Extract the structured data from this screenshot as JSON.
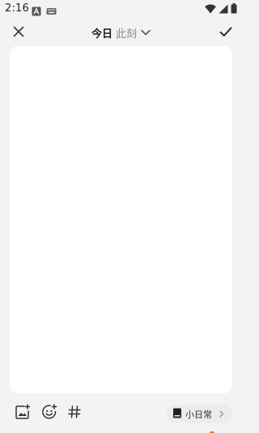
{
  "status_bar": {
    "time": "2:16",
    "icons": [
      "font-a-notification-icon",
      "keyboard-notification-icon",
      "wifi-icon",
      "cellular-signal-icon",
      "battery-icon"
    ]
  },
  "toolbar": {
    "title": "今日",
    "subtitle": "此刻",
    "close_icon": "close-icon",
    "confirm_icon": "checkmark-icon",
    "dropdown_icon": "chevron-down-icon"
  },
  "editor": {
    "content": ""
  },
  "bottom_bar": {
    "icons": [
      "add-image-icon",
      "add-emoji-icon",
      "hashtag-icon"
    ],
    "category": {
      "label": "小日常",
      "icon": "notebook-icon",
      "chevron": "chevron-right-icon"
    }
  },
  "colors": {
    "background": "#f3f3f3",
    "card": "#ffffff",
    "chip": "#ececec",
    "accent": "#f07a3c",
    "text_secondary": "#8a8a8a"
  }
}
